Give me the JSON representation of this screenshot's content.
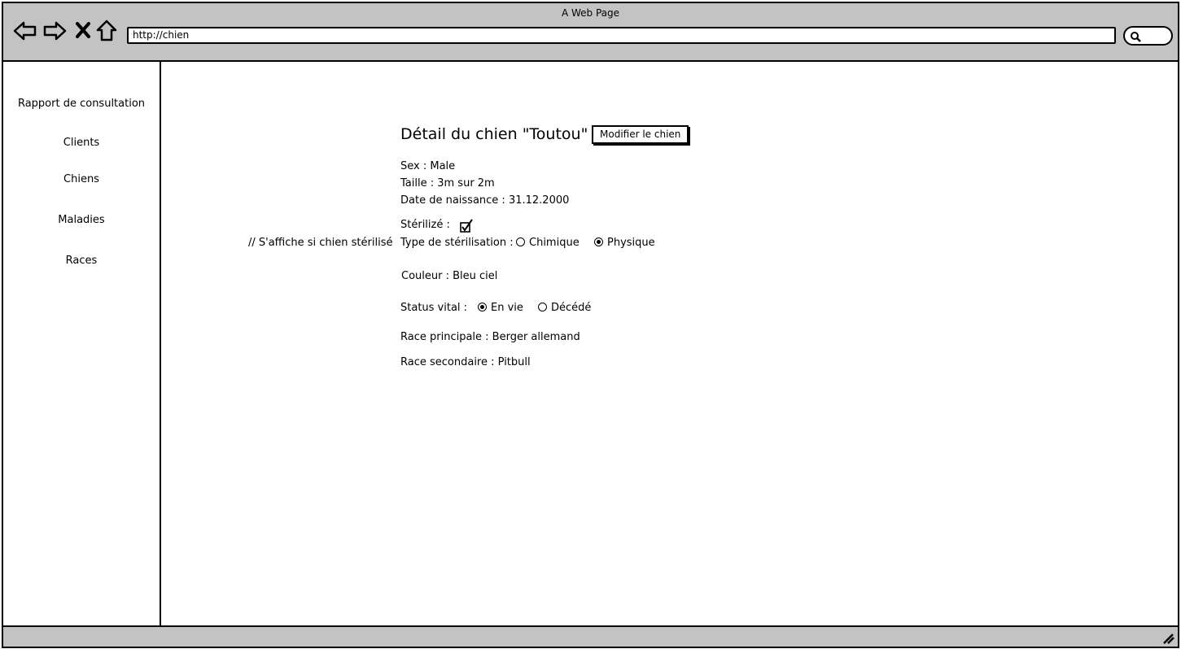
{
  "window": {
    "title": "A Web Page"
  },
  "browser": {
    "url": "http://chien"
  },
  "sidebar": {
    "items": [
      {
        "label": "Rapport de consultation"
      },
      {
        "label": "Clients"
      },
      {
        "label": "Chiens"
      },
      {
        "label": "Maladies"
      },
      {
        "label": "Races"
      }
    ]
  },
  "detail": {
    "title": "Détail du chien \"Toutou\"",
    "edit_button": "Modifier le chien",
    "sex": "Sex : Male",
    "size": "Taille :  3m sur 2m",
    "birthdate": "Date de naissance : 31.12.2000",
    "sterilized_label": "Stérilizé :",
    "sterilized_checked": true,
    "note": "// S'affiche si chien stérilisé",
    "sterilization_type_label": "Type de stérilisation :",
    "sterilization_options": [
      {
        "label": "Chimique",
        "selected": false
      },
      {
        "label": "Physique",
        "selected": true
      }
    ],
    "color": "Couleur :  Bleu ciel",
    "vital_status_label": "Status vital :",
    "vital_options": [
      {
        "label": "En vie",
        "selected": true
      },
      {
        "label": "Décédé",
        "selected": false
      }
    ],
    "main_breed": "Race principale : Berger allemand",
    "secondary_breed": "Race secondaire : Pitbull"
  }
}
